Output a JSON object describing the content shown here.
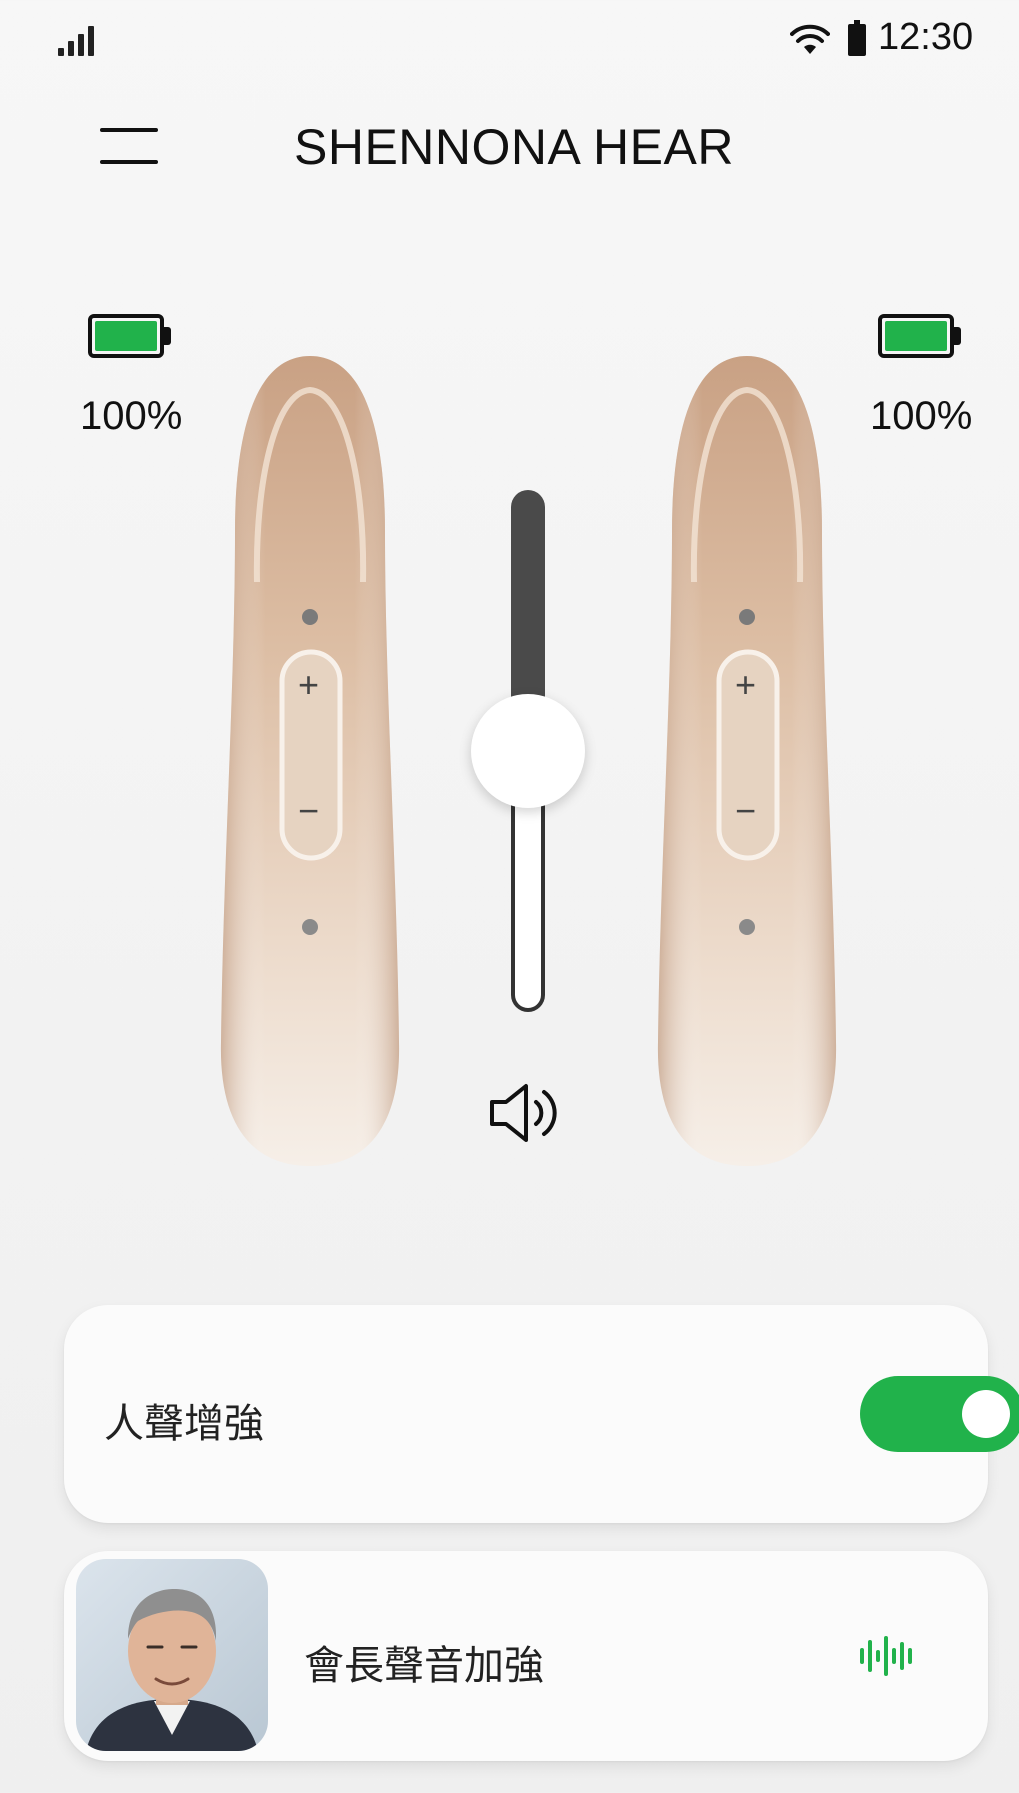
{
  "status_bar": {
    "time": "12:30",
    "icons": [
      "signal-icon",
      "wifi-icon",
      "battery-icon"
    ]
  },
  "header": {
    "menu_icon": "hamburger-menu-icon",
    "title": "SHENNONA HEAR"
  },
  "left_device": {
    "battery_percent": "100%",
    "battery_level": 1.0
  },
  "right_device": {
    "battery_percent": "100%",
    "battery_level": 1.0
  },
  "device_buttons": {
    "plus": "+",
    "minus": "−"
  },
  "volume": {
    "level": 0.5,
    "icon": "speaker-volume-icon"
  },
  "features": [
    {
      "label": "人聲增強",
      "control": "toggle",
      "enabled": true
    },
    {
      "label": "會長聲音加強",
      "control": "sound-wave-icon",
      "avatar": "portrait-avatar"
    }
  ],
  "colors": {
    "accent": "#21b24b",
    "device": "#d9b79b",
    "slider_dark": "#4a4a4a"
  }
}
